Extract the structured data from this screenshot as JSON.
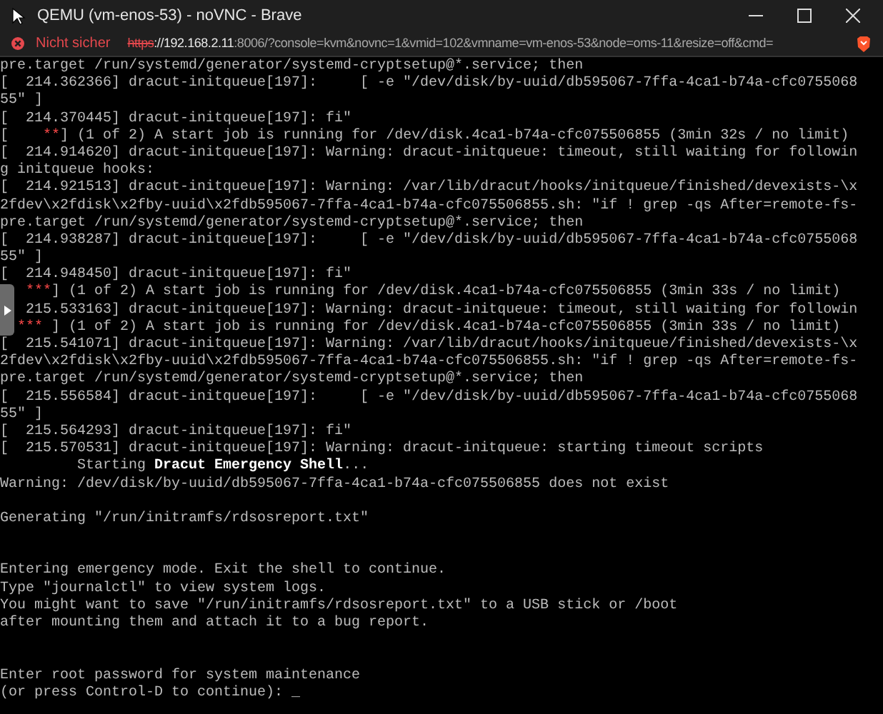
{
  "window": {
    "title": "QEMU (vm-enos-53) - noVNC - Brave"
  },
  "address_bar": {
    "security_label": "Nicht sicher",
    "url_parts": [
      {
        "kind": "scheme",
        "text": "https"
      },
      {
        "kind": "host",
        "text": "://192.168.2.11"
      },
      {
        "kind": "path",
        "text": ":8006/?console=kvm&novnc=1&vmid=102&vmname=vm-enos-53&node=oms-11&resize=off&cmd="
      }
    ]
  },
  "console": {
    "lines": [
      {
        "kind": "text",
        "text": "pre.target /run/systemd/generator/systemd-cryptsetup@*.service; then"
      },
      {
        "kind": "text",
        "text": "[  214.362366] dracut-initqueue[197]:     [ -e \"/dev/disk/by-uuid/db595067-7ffa-4ca1-b74a-cfc0755068"
      },
      {
        "kind": "text",
        "text": "55\" ]"
      },
      {
        "kind": "text",
        "text": "[  214.370445] dracut-initqueue[197]: fi\""
      },
      {
        "kind": "status",
        "parts": [
          {
            "kind": "normal",
            "text": "[    "
          },
          {
            "kind": "red",
            "text": "**"
          },
          {
            "kind": "normal",
            "text": "] (1 of 2) A start job is running for /dev/disk.4ca1-b74a-cfc075506855 (3min 32s / no limit)"
          }
        ]
      },
      {
        "kind": "text",
        "text": "[  214.914620] dracut-initqueue[197]: Warning: dracut-initqueue: timeout, still waiting for followin"
      },
      {
        "kind": "text",
        "text": "g initqueue hooks:"
      },
      {
        "kind": "text",
        "text": "[  214.921513] dracut-initqueue[197]: Warning: /var/lib/dracut/hooks/initqueue/finished/devexists-\\x"
      },
      {
        "kind": "text",
        "text": "2fdev\\x2fdisk\\x2fby-uuid\\x2fdb595067-7ffa-4ca1-b74a-cfc075506855.sh: \"if ! grep -qs After=remote-fs-"
      },
      {
        "kind": "text",
        "text": "pre.target /run/systemd/generator/systemd-cryptsetup@*.service; then"
      },
      {
        "kind": "text",
        "text": "[  214.938287] dracut-initqueue[197]:     [ -e \"/dev/disk/by-uuid/db595067-7ffa-4ca1-b74a-cfc0755068"
      },
      {
        "kind": "text",
        "text": "55\" ]"
      },
      {
        "kind": "text",
        "text": "[  214.948450] dracut-initqueue[197]: fi\""
      },
      {
        "kind": "status",
        "parts": [
          {
            "kind": "red",
            "text": "   ***"
          },
          {
            "kind": "normal",
            "text": "] (1 of 2) A start job is running for /dev/disk.4ca1-b74a-cfc075506855 (3min 33s / no limit)"
          }
        ]
      },
      {
        "kind": "text",
        "text": "   215.533163] dracut-initqueue[197]: Warning: dracut-initqueue: timeout, still waiting for followin"
      },
      {
        "kind": "status",
        "parts": [
          {
            "kind": "red",
            "text": "  ***"
          },
          {
            "kind": "normal",
            "text": " ] (1 of 2) A start job is running for /dev/disk.4ca1-b74a-cfc075506855 (3min 33s / no limit)"
          }
        ]
      },
      {
        "kind": "text",
        "text": "[  215.541071] dracut-initqueue[197]: Warning: /var/lib/dracut/hooks/initqueue/finished/devexists-\\x"
      },
      {
        "kind": "text",
        "text": "2fdev\\x2fdisk\\x2fby-uuid\\x2fdb595067-7ffa-4ca1-b74a-cfc075506855.sh: \"if ! grep -qs After=remote-fs-"
      },
      {
        "kind": "text",
        "text": "pre.target /run/systemd/generator/systemd-cryptsetup@*.service; then"
      },
      {
        "kind": "text",
        "text": "[  215.556584] dracut-initqueue[197]:     [ -e \"/dev/disk/by-uuid/db595067-7ffa-4ca1-b74a-cfc0755068"
      },
      {
        "kind": "text",
        "text": "55\" ]"
      },
      {
        "kind": "text",
        "text": "[  215.564293] dracut-initqueue[197]: fi\""
      },
      {
        "kind": "text",
        "text": "[  215.570531] dracut-initqueue[197]: Warning: dracut-initqueue: starting timeout scripts"
      },
      {
        "kind": "status",
        "parts": [
          {
            "kind": "normal",
            "text": "         Starting "
          },
          {
            "kind": "bold",
            "text": "Dracut Emergency Shell"
          },
          {
            "kind": "normal",
            "text": "..."
          }
        ]
      },
      {
        "kind": "text",
        "text": "Warning: /dev/disk/by-uuid/db595067-7ffa-4ca1-b74a-cfc075506855 does not exist"
      },
      {
        "kind": "blank"
      },
      {
        "kind": "text",
        "text": "Generating \"/run/initramfs/rdsosreport.txt\""
      },
      {
        "kind": "blank"
      },
      {
        "kind": "blank"
      },
      {
        "kind": "text",
        "text": "Entering emergency mode. Exit the shell to continue."
      },
      {
        "kind": "text",
        "text": "Type \"journalctl\" to view system logs."
      },
      {
        "kind": "text",
        "text": "You might want to save \"/run/initramfs/rdsosreport.txt\" to a USB stick or /boot"
      },
      {
        "kind": "text",
        "text": "after mounting them and attach it to a bug report."
      },
      {
        "kind": "blank"
      },
      {
        "kind": "blank"
      },
      {
        "kind": "text",
        "text": "Enter root password for system maintenance"
      },
      {
        "kind": "text",
        "text": "(or press Control-D to continue): _"
      }
    ]
  }
}
